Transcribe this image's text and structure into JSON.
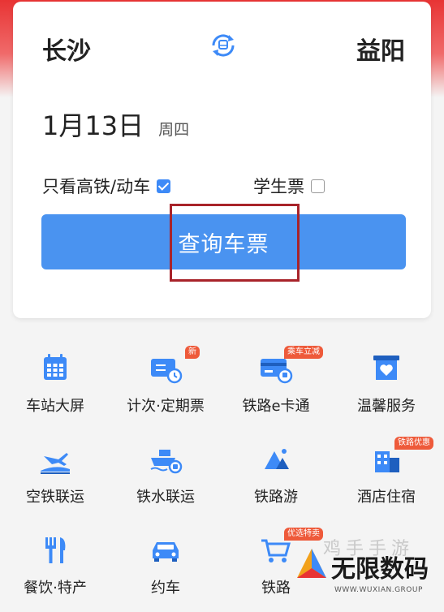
{
  "search": {
    "from_city": "长沙",
    "to_city": "益阳",
    "date": "1月13日",
    "weekday": "周四",
    "high_speed_label": "只看高铁/动车",
    "high_speed_checked": true,
    "student_label": "学生票",
    "student_checked": false,
    "button_label": "查询车票"
  },
  "services": [
    {
      "label": "车站大屏",
      "icon": "calendar-grid-icon"
    },
    {
      "label": "计次·定期票",
      "icon": "ticket-clock-icon",
      "badge": "新"
    },
    {
      "label": "铁路e卡通",
      "icon": "card-icon",
      "badge": "乘车立减"
    },
    {
      "label": "温馨服务",
      "icon": "heart-box-icon"
    },
    {
      "label": "空铁联运",
      "icon": "plane-train-icon"
    },
    {
      "label": "铁水联运",
      "icon": "ship-train-icon"
    },
    {
      "label": "铁路游",
      "icon": "mountain-icon"
    },
    {
      "label": "酒店住宿",
      "icon": "hotel-icon",
      "badge": "铁路优惠"
    },
    {
      "label": "餐饮·特产",
      "icon": "fork-knife-icon"
    },
    {
      "label": "约车",
      "icon": "car-icon"
    },
    {
      "label": "铁路",
      "icon": "cart-icon",
      "badge": "优选特卖"
    }
  ],
  "watermark": {
    "title": "无限数码",
    "faded": "鸡手手游",
    "sub": "WWW.WUXIAN.GROUP"
  },
  "colors": {
    "accent": "#4a93f0",
    "brand_red": "#e83434",
    "highlight_border": "#a8232a",
    "badge": "#ee5a3a"
  }
}
